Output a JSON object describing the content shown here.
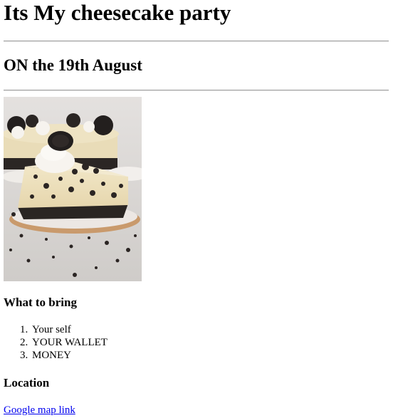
{
  "page": {
    "title": "Its My cheesecake party",
    "subtitle": "ON the 19th August"
  },
  "image": {
    "subject": "oreo-cheesecake-slice",
    "colors": {
      "background": "#d9d6d3",
      "cheesecake": "#efe3c2",
      "crust": "#2a2522",
      "cream": "#f7f4ef",
      "plate": "#ece7e3",
      "plate_rim": "#c99a6c"
    }
  },
  "bring": {
    "heading": "What to bring",
    "items": [
      {
        "number": "1.",
        "text": "Your self"
      },
      {
        "number": "2.",
        "text": "YOUR WALLET"
      },
      {
        "number": "3.",
        "text": "MONEY"
      }
    ]
  },
  "location": {
    "heading": "Location",
    "link_text": "Google map link"
  },
  "colors": {
    "link": "#0000ee",
    "rule": "#9a9a9a"
  }
}
